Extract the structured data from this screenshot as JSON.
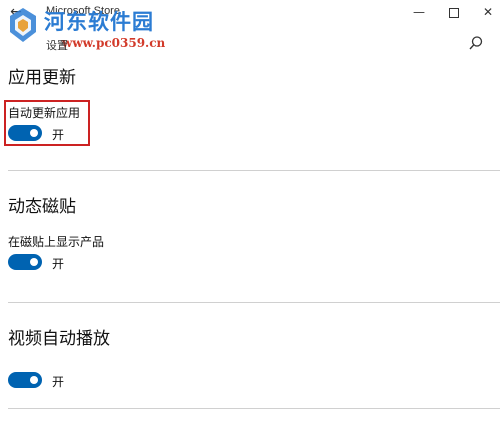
{
  "window": {
    "app_title": "Microsoft Store",
    "back_glyph": "←",
    "minimize_glyph": "—",
    "close_glyph": "✕"
  },
  "watermark": {
    "name": "河东软件园",
    "url": "www.pc0359.cn"
  },
  "page": {
    "title": "设置"
  },
  "sections": [
    {
      "title": "应用更新",
      "setting_label": "自动更新应用",
      "toggle_state": "开",
      "toggle_on": true,
      "highlighted": true
    },
    {
      "title": "动态磁贴",
      "setting_label": "在磁贴上显示产品",
      "toggle_state": "开",
      "toggle_on": true
    },
    {
      "title": "视频自动播放",
      "setting_label": "",
      "toggle_state": "开",
      "toggle_on": true
    }
  ],
  "colors": {
    "accent": "#0063b1",
    "highlight": "#cc2222",
    "watermark_blue": "#2b7cd3",
    "watermark_red": "#d23a2a"
  }
}
